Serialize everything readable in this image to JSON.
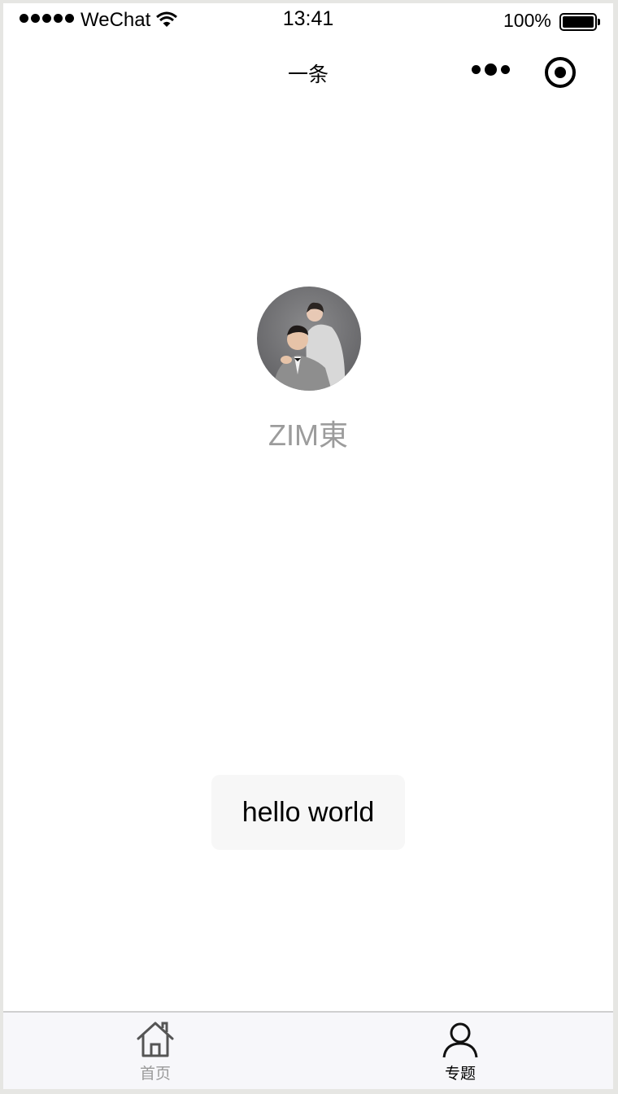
{
  "status_bar": {
    "carrier": "WeChat",
    "time": "13:41",
    "battery": "100%",
    "battery_level": 1.0
  },
  "nav_bar": {
    "title": "一条"
  },
  "profile": {
    "nickname": "ZIM東"
  },
  "main": {
    "button_label": "hello world"
  },
  "tab_bar": {
    "items": [
      {
        "label": "首页",
        "icon": "home-icon",
        "selected": false
      },
      {
        "label": "专题",
        "icon": "user-icon",
        "selected": true
      }
    ],
    "active_color": "#000000",
    "inactive_color": "#9a9a9a"
  }
}
